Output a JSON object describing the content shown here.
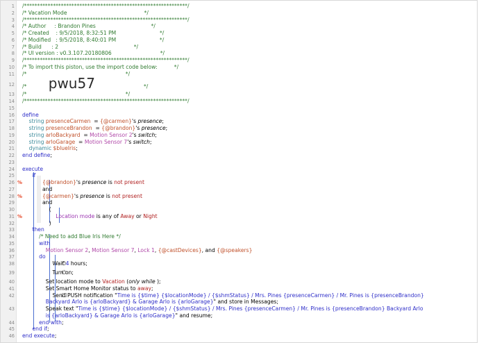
{
  "lines": [
    {
      "n": "1",
      "c": [
        [
          "cm",
          "/**************************************************************/"
        ]
      ]
    },
    {
      "n": "2",
      "c": [
        [
          "cm",
          "/* Vacation Mode                                              */"
        ]
      ]
    },
    {
      "n": "3",
      "c": [
        [
          "cm",
          "/**************************************************************/"
        ]
      ]
    },
    {
      "n": "4",
      "c": [
        [
          "cm",
          "/* Author     : Brandon Pines                                 */"
        ]
      ]
    },
    {
      "n": "5",
      "c": [
        [
          "cm",
          "/* Created    : 9/5/2018, 8:32:51 PM                          */"
        ]
      ]
    },
    {
      "n": "6",
      "c": [
        [
          "cm",
          "/* Modified   : 9/5/2018, 8:40:01 PM                          */"
        ]
      ]
    },
    {
      "n": "7",
      "c": [
        [
          "cm",
          "/* Build      : 2                                             */"
        ]
      ]
    },
    {
      "n": "8",
      "c": [
        [
          "cm",
          "/* UI version : v0.3.107.20180806                             */"
        ]
      ]
    },
    {
      "n": "9",
      "c": [
        [
          "cm",
          "/**************************************************************/"
        ]
      ]
    },
    {
      "n": "10",
      "c": [
        [
          "cm",
          "/* To import this piston, use the import code below:          */"
        ]
      ]
    },
    {
      "n": "11",
      "c": [
        [
          "cm",
          "/*                                                           */"
        ]
      ]
    },
    {
      "n": "12",
      "c": [
        [
          "cm",
          "/*             "
        ],
        [
          "big",
          "pwu57"
        ],
        [
          "cm",
          "                             */"
        ]
      ]
    },
    {
      "n": "13",
      "c": [
        [
          "cm",
          "/*                                                           */"
        ]
      ]
    },
    {
      "n": "14",
      "c": [
        [
          "cm",
          "/**************************************************************/"
        ]
      ]
    },
    {
      "n": "15",
      "c": []
    },
    {
      "n": "16",
      "c": [
        [
          "kw",
          "define"
        ]
      ]
    },
    {
      "n": "17",
      "c": [
        [
          "ty",
          "    string "
        ],
        [
          "var",
          "presenceCarmen"
        ],
        [
          "",
          "  = "
        ],
        [
          "var",
          "{@carmen}"
        ],
        [
          "",
          "'s "
        ],
        [
          "it",
          "presence"
        ],
        [
          "",
          ";"
        ]
      ]
    },
    {
      "n": "18",
      "c": [
        [
          "ty",
          "    string "
        ],
        [
          "var",
          "presenceBrandon"
        ],
        [
          "",
          "  = "
        ],
        [
          "var",
          "{@brandon}"
        ],
        [
          "",
          "'s "
        ],
        [
          "it",
          "presence"
        ],
        [
          "",
          ";"
        ]
      ]
    },
    {
      "n": "19",
      "c": [
        [
          "ty",
          "    string "
        ],
        [
          "var",
          "arloBackyard"
        ],
        [
          "",
          "  = "
        ],
        [
          "id",
          "Motion Sensor 2"
        ],
        [
          "",
          "'s "
        ],
        [
          "it",
          "switch"
        ],
        [
          "",
          ";"
        ]
      ]
    },
    {
      "n": "20",
      "c": [
        [
          "ty",
          "    string "
        ],
        [
          "var",
          "arloGarage"
        ],
        [
          "",
          "  = "
        ],
        [
          "id",
          "Motion Sensor 7"
        ],
        [
          "",
          "'s "
        ],
        [
          "it",
          "switch"
        ],
        [
          "",
          ";"
        ]
      ]
    },
    {
      "n": "21",
      "c": [
        [
          "ty",
          "    dynamic "
        ],
        [
          "var",
          "$blueIris"
        ],
        [
          "",
          ";"
        ]
      ]
    },
    {
      "n": "22",
      "c": [
        [
          "kw",
          "end define"
        ],
        [
          "",
          ";"
        ]
      ]
    },
    {
      "n": "23",
      "c": []
    },
    {
      "n": "24",
      "c": [
        [
          "kw",
          "execute"
        ]
      ]
    },
    {
      "n": "25",
      "c": [
        [
          "kw",
          "      if"
        ]
      ]
    },
    {
      "n": "26",
      "f": "%",
      "c": [
        [
          "var",
          "            {@brandon}"
        ],
        [
          "",
          "'s "
        ],
        [
          "it",
          "presence"
        ],
        [
          "",
          " is "
        ],
        [
          "op",
          "not present"
        ]
      ]
    },
    {
      "n": "27",
      "c": [
        [
          "",
          "            and"
        ]
      ]
    },
    {
      "n": "28",
      "f": "%",
      "c": [
        [
          "var",
          "            {@carmen}"
        ],
        [
          "",
          "'s "
        ],
        [
          "it",
          "presence"
        ],
        [
          "",
          " is "
        ],
        [
          "op",
          "not present"
        ]
      ]
    },
    {
      "n": "29",
      "c": [
        [
          "",
          "            and"
        ]
      ]
    },
    {
      "n": "30",
      "c": [
        [
          "",
          "                ("
        ]
      ]
    },
    {
      "n": "31",
      "f": "%",
      "c": [
        [
          "dv",
          "                    Location mode"
        ],
        [
          "",
          " is any of "
        ],
        [
          "val",
          "Away"
        ],
        [
          "",
          " or "
        ],
        [
          "val",
          "Night"
        ]
      ]
    },
    {
      "n": "32",
      "c": [
        [
          "",
          "                )"
        ]
      ]
    },
    {
      "n": "33",
      "c": [
        [
          "kw",
          "      then"
        ]
      ]
    },
    {
      "n": "34",
      "c": [
        [
          "cm",
          "          /* Need to add Blue Iris Here */"
        ]
      ]
    },
    {
      "n": "35",
      "c": [
        [
          "kw",
          "          with"
        ]
      ]
    },
    {
      "n": "36",
      "c": [
        [
          "id",
          "              Motion Sensor 2"
        ],
        [
          "",
          ", "
        ],
        [
          "id",
          "Motion Sensor 7"
        ],
        [
          "",
          ", "
        ],
        [
          "id",
          "Lock 1"
        ],
        [
          "",
          ", "
        ],
        [
          "var",
          "{@castDevices}"
        ],
        [
          "",
          ", and "
        ],
        [
          "var",
          "{@speakers}"
        ]
      ]
    },
    {
      "n": "37",
      "c": [
        [
          "kw",
          "          do"
        ]
      ]
    },
    {
      "n": "38",
      "ic": "⏱",
      "c": [
        [
          "",
          "                  Wait "
        ],
        [
          "num",
          "4"
        ],
        [
          "",
          " hours;"
        ]
      ]
    },
    {
      "n": "39",
      "ic": "⏻",
      "c": [
        [
          "",
          "                  Turn on;"
        ]
      ]
    },
    {
      "n": "40",
      "c": [
        [
          "",
          "              Set location mode to "
        ],
        [
          "val",
          "Vacation"
        ],
        [
          "",
          " ("
        ],
        [
          "it",
          "only while"
        ],
        [
          "",
          " );"
        ]
      ]
    },
    {
      "n": "41",
      "c": [
        [
          "",
          "              Set Smart Home Monitor status to "
        ],
        [
          "val",
          "away"
        ],
        [
          "",
          ";"
        ]
      ]
    },
    {
      "n": "42a",
      "ic": "☐",
      "c": [
        [
          "",
          "                  Send PUSH notification \""
        ],
        [
          "kw",
          "Time is {$time} {$locationMode} / {$shmStatus} / Mrs. Pines {presenceCarmen} / Mr. Pines is {presenceBrandon}"
        ]
      ]
    },
    {
      "n": "",
      "c": [
        [
          "kw",
          "              Backyard Arlo is {arloBackyard} & Garage Arlo is {arloGarage}"
        ],
        [
          "",
          "\" and store in Messages;"
        ]
      ]
    },
    {
      "n": "43a",
      "c": [
        [
          "",
          "              Speak text \""
        ],
        [
          "kw",
          "Time is {$time} {$locationMode} / {$shmStatus} / Mrs. Pines {presenceCarmen} / Mr. Pines is {presenceBrandon} Backyard Arlo"
        ]
      ]
    },
    {
      "n": "",
      "c": [
        [
          "kw",
          "              is {arloBackyard} & Garage Arlo is {arloGarage}"
        ],
        [
          "",
          "\" and resume;"
        ]
      ]
    },
    {
      "n": "44",
      "c": [
        [
          "kw",
          "          end with"
        ],
        [
          "",
          ";"
        ]
      ]
    },
    {
      "n": "45",
      "c": [
        [
          "kw",
          "      end if"
        ],
        [
          "",
          ";"
        ]
      ]
    },
    {
      "n": "46",
      "c": [
        [
          "kw",
          "end execute"
        ],
        [
          "",
          ";"
        ]
      ]
    }
  ]
}
